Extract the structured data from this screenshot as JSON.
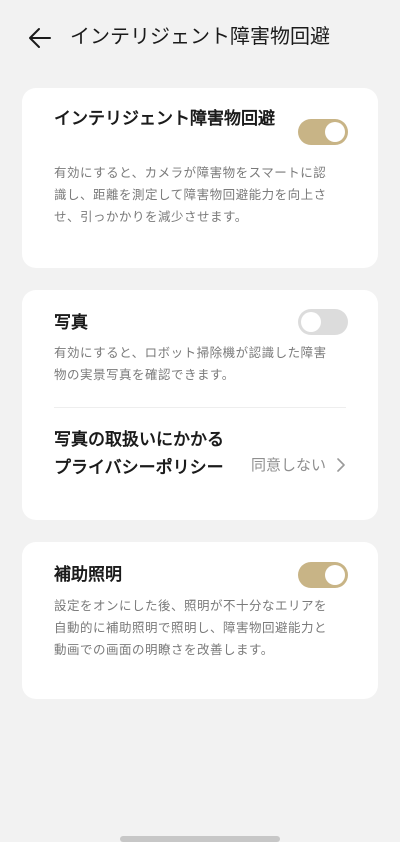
{
  "header": {
    "back_icon": "arrow-left-icon",
    "title": "インテリジェント障害物回避"
  },
  "settings": {
    "obstacle_avoidance": {
      "title": "インテリジェント障害物回避",
      "description": "有効にすると、カメラが障害物をスマートに認識し、距離を測定して障害物回避能力を向上させ、引っかかりを減少させます。",
      "enabled": true
    },
    "photos": {
      "title": "写真",
      "description": "有効にすると、ロボット掃除機が認識した障害物の実景写真を確認できます。",
      "enabled": false
    },
    "privacy_policy": {
      "title": "写真の取扱いにかかるプライバシーポリシー",
      "value": "同意しない",
      "chevron_icon": "chevron-right-icon"
    },
    "aux_lighting": {
      "title": "補助照明",
      "description": "設定をオンにした後、照明が不十分なエリアを自動的に補助照明で照明し、障害物回避能力と動画での画面の明瞭さを改善します。",
      "enabled": true
    }
  },
  "colors": {
    "toggle_on": "#c8b486",
    "toggle_off": "#dcdcdc",
    "background": "#f2f2f2",
    "card": "#ffffff"
  }
}
